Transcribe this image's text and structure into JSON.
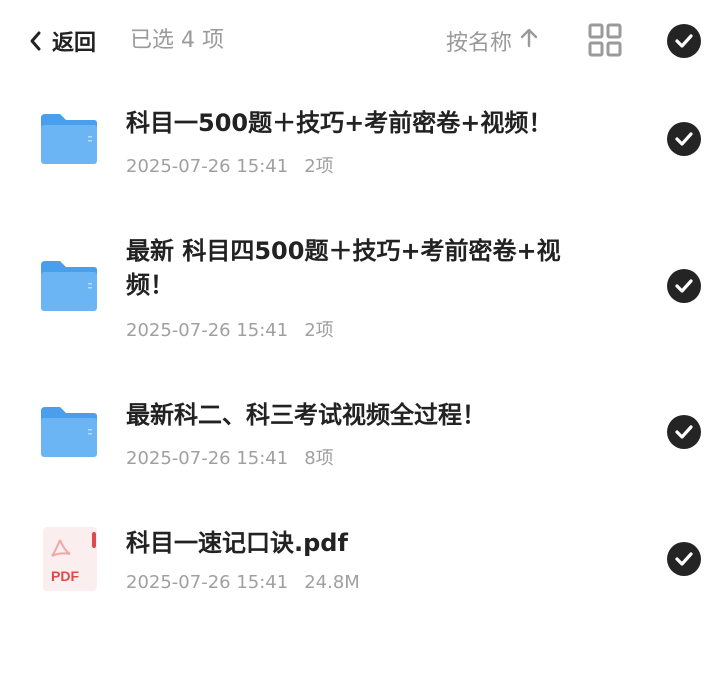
{
  "header": {
    "back_label": "返回",
    "selection_text": "已选 4 项",
    "sort_label": "按名称"
  },
  "files": [
    {
      "type": "folder",
      "name": "科目一500题＋技巧+考前密卷+视频！",
      "date": "2025-07-26 15:41",
      "size": "2项",
      "selected": true
    },
    {
      "type": "folder",
      "name": "最新 科目四500题＋技巧+考前密卷+视频！",
      "date": "2025-07-26 15:41",
      "size": "2项",
      "selected": true
    },
    {
      "type": "folder",
      "name": "最新科二、科三考试视频全过程！",
      "date": "2025-07-26 15:41",
      "size": "8项",
      "selected": true
    },
    {
      "type": "pdf",
      "icon_label": "PDF",
      "name": "科目一速记口诀.pdf",
      "date": "2025-07-26 15:41",
      "size": "24.8M",
      "selected": true
    }
  ],
  "colors": {
    "folder": "#6cb5f5",
    "pdf_red": "#e0494a",
    "check_bg": "#242424",
    "muted_text": "#9a9a9a"
  }
}
